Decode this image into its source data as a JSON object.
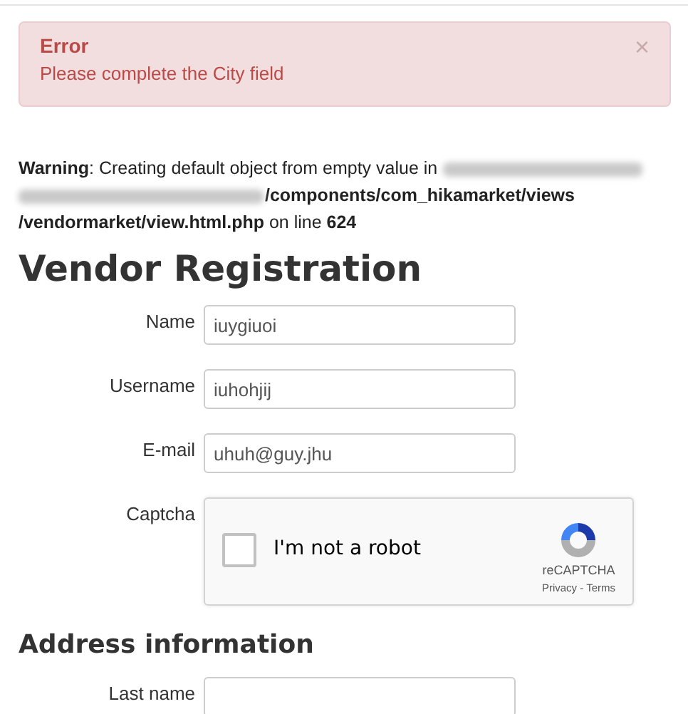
{
  "alert": {
    "title": "Error",
    "message": "Please complete the City field",
    "close": "×"
  },
  "warning": {
    "before": "**Warning**: Creating default object from empty value in",
    "after": [
      "**/components/com_hikamarket/views**",
      "**/vendormarket/view.html.php** on line **624**"
    ]
  },
  "title": "Vendor Registration",
  "fields": [
    {
      "label": "Name",
      "value": "iuygiuoi"
    },
    {
      "label": "Username",
      "value": "iuhohjij"
    },
    {
      "label": "E-mail",
      "value": "uhuh@guy.jhu"
    }
  ],
  "captcha": {
    "label": "Captcha",
    "checked": false,
    "text": "I'm not a robot",
    "brand": "reCAPTCHA",
    "links": "Privacy - Terms"
  },
  "address": {
    "title": "Address information",
    "fields": [
      {
        "label": "Last name"
      }
    ]
  }
}
